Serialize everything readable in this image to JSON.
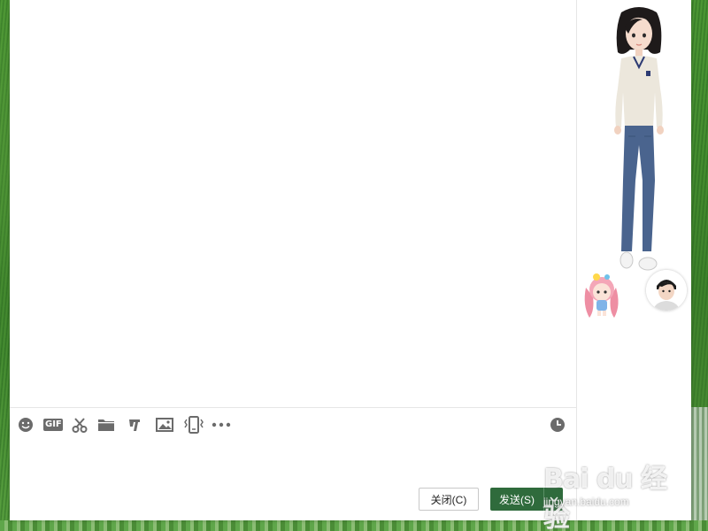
{
  "colors": {
    "accent": "#2f6b3c",
    "icon": "#6b6b6b",
    "border": "#e6e6e6"
  },
  "toolbar": {
    "items": [
      {
        "name": "emoji-icon"
      },
      {
        "name": "gif-icon",
        "label": "GIF"
      },
      {
        "name": "scissors-icon"
      },
      {
        "name": "folder-icon"
      },
      {
        "name": "music-note-icon"
      },
      {
        "name": "image-icon"
      },
      {
        "name": "vibrate-phone-icon"
      },
      {
        "name": "more-icon"
      }
    ],
    "history_icon": "clock-icon"
  },
  "buttons": {
    "close_label": "关闭(C)",
    "send_label": "发送(S)",
    "send_dropdown_icon": "chevron-down-icon"
  },
  "watermark": {
    "logo": "Bai du 经验",
    "sub": "jingyan.baidu.com"
  }
}
